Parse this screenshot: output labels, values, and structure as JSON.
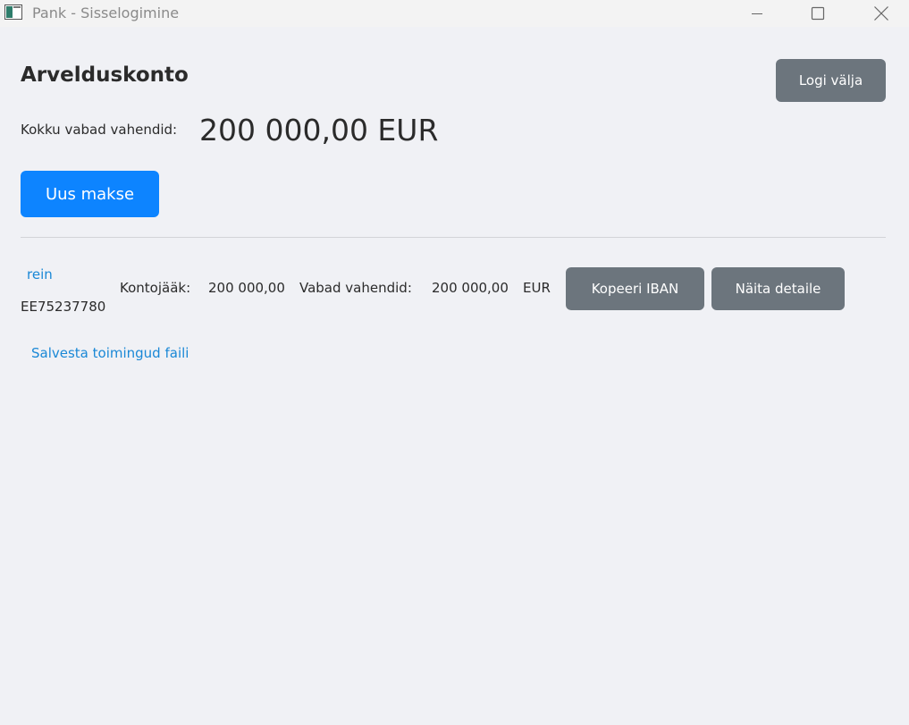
{
  "window": {
    "title": "Pank - Sisselogimine",
    "icon": "app-window-icon",
    "controls": [
      "minimize-icon",
      "maximize-icon",
      "close-icon"
    ]
  },
  "header": {
    "title": "Arvelduskonto",
    "logout_label": "Logi välja"
  },
  "summary": {
    "label": "Kokku vabad vahendid:",
    "amount": "200 000,00 EUR"
  },
  "actions": {
    "new_payment_label": "Uus makse"
  },
  "accounts": [
    {
      "name": "rein",
      "iban": "EE75237780",
      "balance_label": "Kontojääk:",
      "balance_value": "200 000,00",
      "available_label": "Vabad vahendid:",
      "available_value": "200 000,00",
      "currency": "EUR",
      "copy_iban_label": "Kopeeri IBAN",
      "details_label": "Näita detaile"
    }
  ],
  "footer": {
    "save_link": "Salvesta toimingud faili"
  },
  "colors": {
    "background": "#f0f1f5",
    "primary": "#0d84ff",
    "secondary": "#6c757d",
    "link": "#1a88d6"
  }
}
